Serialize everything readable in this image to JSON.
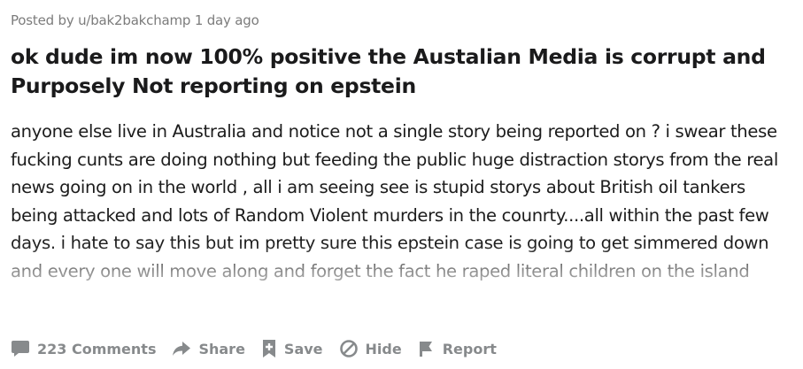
{
  "post": {
    "meta": "Posted by u/bak2bakchamp 1 day ago",
    "title": "ok dude im now 100% positive the Austalian Media is corrupt and Purposely Not reporting on epstein",
    "body": "anyone else live in Australia and notice not a single story being reported on ? i swear these fucking cunts are doing nothing but feeding the public huge distraction storys from the real news going on in the world , all i am seeing see is stupid storys about British oil tankers being attacked and lots of Random Violent murders in the counrty....all within the past few days. i hate to say this but im pretty sure this epstein case is going to get simmered down and every one will move along and forget the fact he raped literal children on the island"
  },
  "actions": {
    "comments": {
      "label": "223 Comments",
      "icon": "comment-icon"
    },
    "share": {
      "label": "Share",
      "icon": "share-icon"
    },
    "save": {
      "label": "Save",
      "icon": "save-icon"
    },
    "hide": {
      "label": "Hide",
      "icon": "hide-icon"
    },
    "report": {
      "label": "Report",
      "icon": "report-icon"
    }
  },
  "colors": {
    "text": "#1a1a1b",
    "meta": "#7c7c7c",
    "action": "#878a8c"
  }
}
